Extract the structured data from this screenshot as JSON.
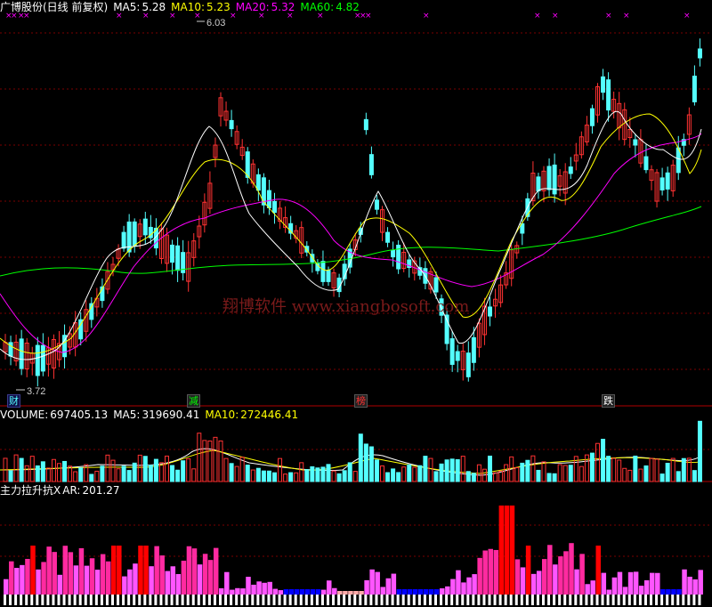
{
  "chart_header": {
    "title": "广博股份(日线 前复权)",
    "ma5_label": "MA5:",
    "ma5_value": "5.28",
    "ma10_label": "MA10:",
    "ma10_value": "5.23",
    "ma20_label": "MA20:",
    "ma20_value": "5.32",
    "ma60_label": "MA60:",
    "ma60_value": "4.82"
  },
  "price_annotations": {
    "high_label": "6.03",
    "low_label": "3.72"
  },
  "watermark": "翔博软件 www.xiangbosoft.com",
  "event_markers": [
    {
      "id": "cai",
      "label": "财"
    },
    {
      "id": "jian",
      "label": "减"
    },
    {
      "id": "bang",
      "label": "榜"
    },
    {
      "id": "die",
      "label": "跌"
    }
  ],
  "volume_header": {
    "volume_label": "VOLUME:",
    "volume_value": "697405.13",
    "ma5_label": "MA5:",
    "ma5_value": "319690.41",
    "ma10_label": "MA10:",
    "ma10_value": "272446.41"
  },
  "indicator_header": {
    "name": "主力拉升抗X",
    "ar_label": "AR:",
    "ar_value": "201.27"
  },
  "colors": {
    "background": "#000000",
    "up": "#ff3232",
    "down": "#54ffff",
    "ma5": "#ffffff",
    "ma10": "#ffff00",
    "ma20": "#ff00ff",
    "ma60": "#00ff00",
    "indicator_strong": "#ff0000",
    "indicator_mid": "#ff2aa0",
    "indicator_weak": "#ff55ff",
    "indicator_blue": "#0000ff",
    "indicator_pink": "#ffaaaa"
  }
}
